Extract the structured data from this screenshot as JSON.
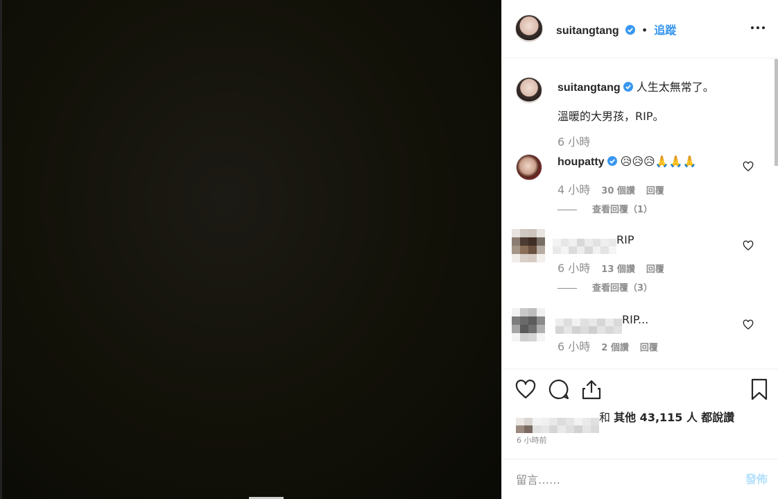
{
  "post": {
    "username": "suitangtang",
    "follow_label": "追蹤",
    "dot": "•",
    "more_icon": "more-options-icon"
  },
  "caption": {
    "username": "suitangtang",
    "line1": "人生太無常了。",
    "line2": "溫暖的大男孩，RIP。",
    "time": "6 小時"
  },
  "comments": [
    {
      "username": "houpatty",
      "text": "😥😥😥🙏🙏🙏",
      "time": "4 小時",
      "likes": "30 個讚",
      "reply": "回覆",
      "view_replies": "查看回覆（1）"
    },
    {
      "text": "RIP",
      "time": "6 小時",
      "likes": "13 個讚",
      "reply": "回覆",
      "view_replies": "查看回覆（3）"
    },
    {
      "text": "RIP...",
      "time": "6 小時",
      "likes": "2 個讚",
      "reply": "回覆"
    }
  ],
  "actions": {
    "likes_prefix": "和",
    "likes_others": "其他 43,115 人",
    "likes_suffix": "都說讚",
    "timestamp": "6 小時前"
  },
  "comment_box": {
    "placeholder": "留言……",
    "post_label": "發佈"
  },
  "colors": {
    "accent": "#3897f0",
    "post_disabled": "#b2dffc",
    "meta_gray": "#8e8e8e"
  }
}
